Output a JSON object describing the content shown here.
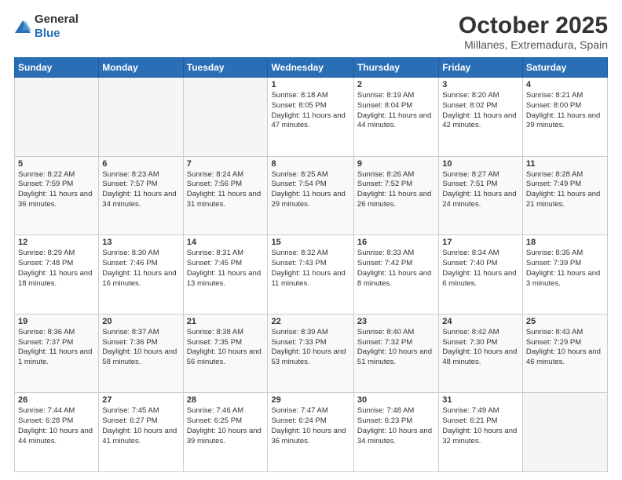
{
  "logo": {
    "general": "General",
    "blue": "Blue"
  },
  "header": {
    "month": "October 2025",
    "location": "Millanes, Extremadura, Spain"
  },
  "weekdays": [
    "Sunday",
    "Monday",
    "Tuesday",
    "Wednesday",
    "Thursday",
    "Friday",
    "Saturday"
  ],
  "weeks": [
    [
      {
        "day": "",
        "empty": true
      },
      {
        "day": "",
        "empty": true
      },
      {
        "day": "",
        "empty": true
      },
      {
        "day": "1",
        "sunrise": "8:18 AM",
        "sunset": "8:05 PM",
        "daylight": "11 hours and 47 minutes."
      },
      {
        "day": "2",
        "sunrise": "8:19 AM",
        "sunset": "8:04 PM",
        "daylight": "11 hours and 44 minutes."
      },
      {
        "day": "3",
        "sunrise": "8:20 AM",
        "sunset": "8:02 PM",
        "daylight": "11 hours and 42 minutes."
      },
      {
        "day": "4",
        "sunrise": "8:21 AM",
        "sunset": "8:00 PM",
        "daylight": "11 hours and 39 minutes."
      }
    ],
    [
      {
        "day": "5",
        "sunrise": "8:22 AM",
        "sunset": "7:59 PM",
        "daylight": "11 hours and 36 minutes."
      },
      {
        "day": "6",
        "sunrise": "8:23 AM",
        "sunset": "7:57 PM",
        "daylight": "11 hours and 34 minutes."
      },
      {
        "day": "7",
        "sunrise": "8:24 AM",
        "sunset": "7:56 PM",
        "daylight": "11 hours and 31 minutes."
      },
      {
        "day": "8",
        "sunrise": "8:25 AM",
        "sunset": "7:54 PM",
        "daylight": "11 hours and 29 minutes."
      },
      {
        "day": "9",
        "sunrise": "8:26 AM",
        "sunset": "7:52 PM",
        "daylight": "11 hours and 26 minutes."
      },
      {
        "day": "10",
        "sunrise": "8:27 AM",
        "sunset": "7:51 PM",
        "daylight": "11 hours and 24 minutes."
      },
      {
        "day": "11",
        "sunrise": "8:28 AM",
        "sunset": "7:49 PM",
        "daylight": "11 hours and 21 minutes."
      }
    ],
    [
      {
        "day": "12",
        "sunrise": "8:29 AM",
        "sunset": "7:48 PM",
        "daylight": "11 hours and 18 minutes."
      },
      {
        "day": "13",
        "sunrise": "8:30 AM",
        "sunset": "7:46 PM",
        "daylight": "11 hours and 16 minutes."
      },
      {
        "day": "14",
        "sunrise": "8:31 AM",
        "sunset": "7:45 PM",
        "daylight": "11 hours and 13 minutes."
      },
      {
        "day": "15",
        "sunrise": "8:32 AM",
        "sunset": "7:43 PM",
        "daylight": "11 hours and 11 minutes."
      },
      {
        "day": "16",
        "sunrise": "8:33 AM",
        "sunset": "7:42 PM",
        "daylight": "11 hours and 8 minutes."
      },
      {
        "day": "17",
        "sunrise": "8:34 AM",
        "sunset": "7:40 PM",
        "daylight": "11 hours and 6 minutes."
      },
      {
        "day": "18",
        "sunrise": "8:35 AM",
        "sunset": "7:39 PM",
        "daylight": "11 hours and 3 minutes."
      }
    ],
    [
      {
        "day": "19",
        "sunrise": "8:36 AM",
        "sunset": "7:37 PM",
        "daylight": "11 hours and 1 minute."
      },
      {
        "day": "20",
        "sunrise": "8:37 AM",
        "sunset": "7:36 PM",
        "daylight": "10 hours and 58 minutes."
      },
      {
        "day": "21",
        "sunrise": "8:38 AM",
        "sunset": "7:35 PM",
        "daylight": "10 hours and 56 minutes."
      },
      {
        "day": "22",
        "sunrise": "8:39 AM",
        "sunset": "7:33 PM",
        "daylight": "10 hours and 53 minutes."
      },
      {
        "day": "23",
        "sunrise": "8:40 AM",
        "sunset": "7:32 PM",
        "daylight": "10 hours and 51 minutes."
      },
      {
        "day": "24",
        "sunrise": "8:42 AM",
        "sunset": "7:30 PM",
        "daylight": "10 hours and 48 minutes."
      },
      {
        "day": "25",
        "sunrise": "8:43 AM",
        "sunset": "7:29 PM",
        "daylight": "10 hours and 46 minutes."
      }
    ],
    [
      {
        "day": "26",
        "sunrise": "7:44 AM",
        "sunset": "6:28 PM",
        "daylight": "10 hours and 44 minutes."
      },
      {
        "day": "27",
        "sunrise": "7:45 AM",
        "sunset": "6:27 PM",
        "daylight": "10 hours and 41 minutes."
      },
      {
        "day": "28",
        "sunrise": "7:46 AM",
        "sunset": "6:25 PM",
        "daylight": "10 hours and 39 minutes."
      },
      {
        "day": "29",
        "sunrise": "7:47 AM",
        "sunset": "6:24 PM",
        "daylight": "10 hours and 36 minutes."
      },
      {
        "day": "30",
        "sunrise": "7:48 AM",
        "sunset": "6:23 PM",
        "daylight": "10 hours and 34 minutes."
      },
      {
        "day": "31",
        "sunrise": "7:49 AM",
        "sunset": "6:21 PM",
        "daylight": "10 hours and 32 minutes."
      },
      {
        "day": "",
        "empty": true
      }
    ]
  ],
  "labels": {
    "sunrise": "Sunrise:",
    "sunset": "Sunset:",
    "daylight": "Daylight:"
  }
}
